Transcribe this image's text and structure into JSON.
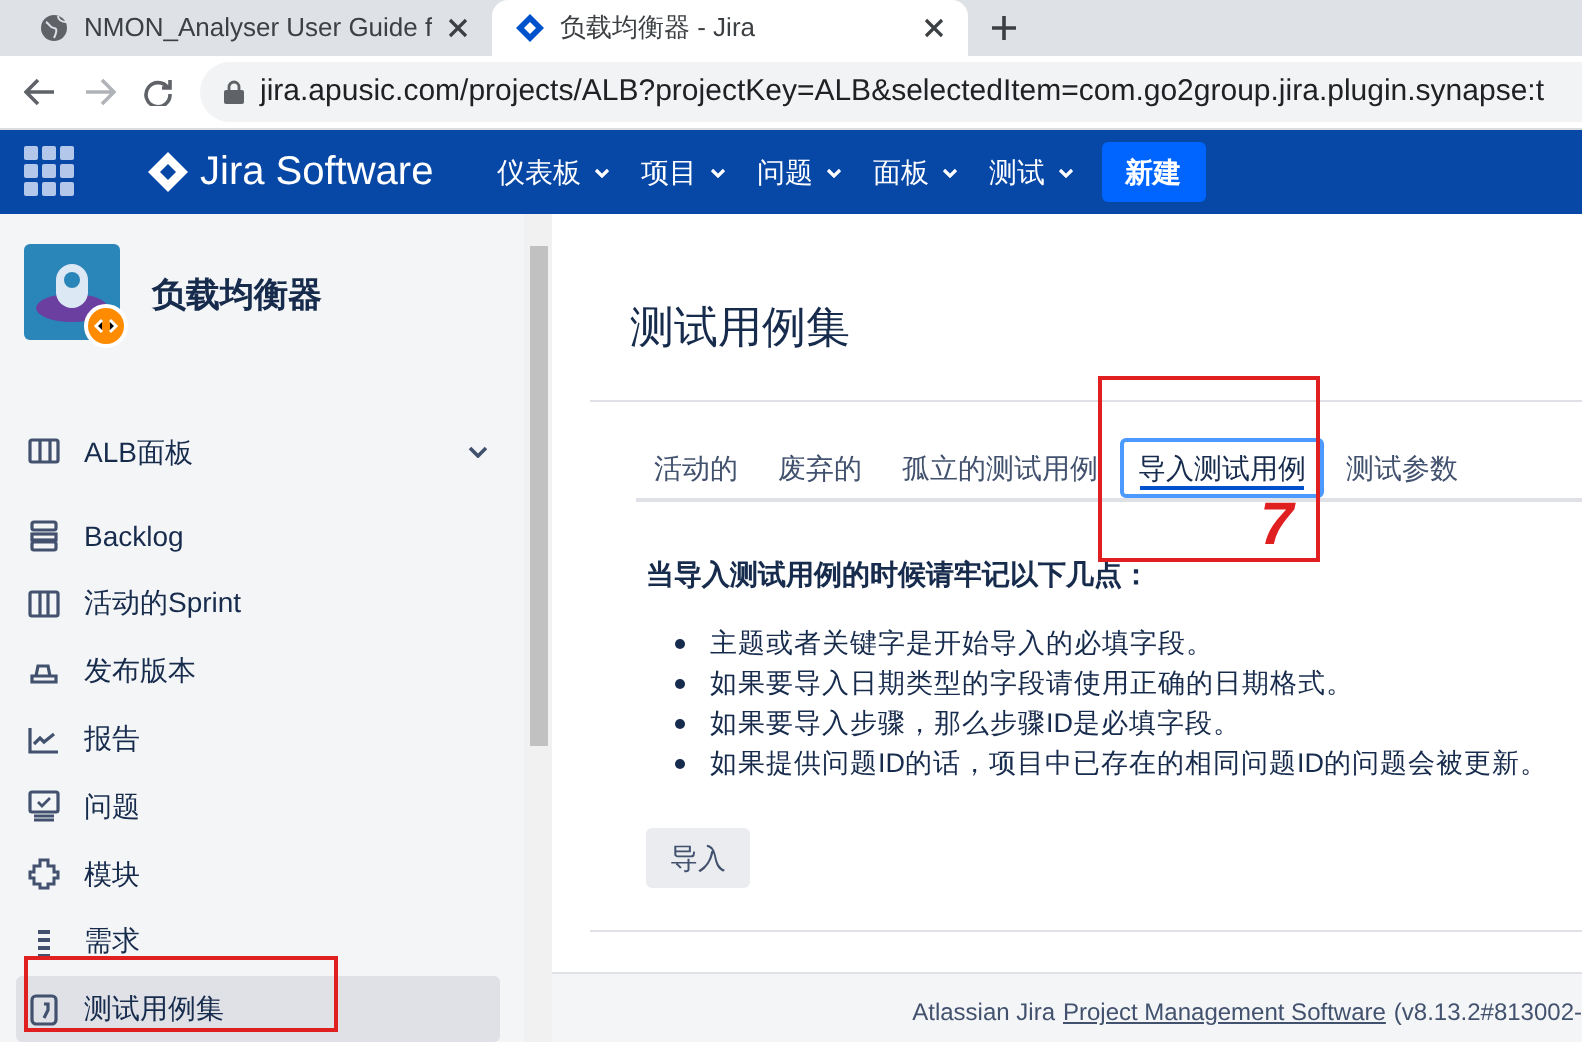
{
  "browser": {
    "tabs": [
      {
        "title": "NMON_Analyser User Guide f",
        "selected": false
      },
      {
        "title": "负载均衡器 - Jira",
        "selected": true
      }
    ],
    "url": "jira.apusic.com/projects/ALB?projectKey=ALB&selectedItem=com.go2group.jira.plugin.synapse:t"
  },
  "topnav": {
    "product": "Jira Software",
    "menus": [
      "仪表板",
      "项目",
      "问题",
      "面板",
      "测试"
    ],
    "create": "新建"
  },
  "sidebar": {
    "project": "负载均衡器",
    "items": [
      {
        "label": "ALB面板",
        "kind": "board",
        "dropdown": true,
        "selected": false
      },
      {
        "label": "Backlog",
        "kind": "backlog",
        "dropdown": false,
        "selected": false
      },
      {
        "label": "活动的Sprint",
        "kind": "sprint",
        "dropdown": false,
        "selected": false
      },
      {
        "label": "发布版本",
        "kind": "release",
        "dropdown": false,
        "selected": false
      },
      {
        "label": "报告",
        "kind": "report",
        "dropdown": false,
        "selected": false
      },
      {
        "label": "问题",
        "kind": "issue",
        "dropdown": false,
        "selected": false
      },
      {
        "label": "模块",
        "kind": "component",
        "dropdown": false,
        "selected": false
      },
      {
        "label": "需求",
        "kind": "requirement",
        "dropdown": false,
        "selected": false
      },
      {
        "label": "测试用例集",
        "kind": "testsuite",
        "dropdown": false,
        "selected": true
      }
    ]
  },
  "main": {
    "title": "测试用例集",
    "tabs": [
      {
        "label": "活动的",
        "selected": false
      },
      {
        "label": "废弃的",
        "selected": false
      },
      {
        "label": "孤立的测试用例",
        "selected": false
      },
      {
        "label": "导入测试用例",
        "selected": true
      },
      {
        "label": "测试参数",
        "selected": false
      }
    ],
    "heading": "当导入测试用例的时候请牢记以下几点：",
    "bullets": [
      "主题或者关键字是开始导入的必填字段。",
      "如果要导入日期类型的字段请使用正确的日期格式。",
      "如果要导入步骤，那么步骤ID是必填字段。",
      "如果提供问题ID的话，项目中已存在的相同问题ID的问题会被更新。"
    ],
    "button": "导入"
  },
  "footer": {
    "prefix": "Atlassian Jira",
    "link": "Project Management Software",
    "version": "(v8.13.2#813002-"
  },
  "annotation": {
    "label": "7"
  }
}
